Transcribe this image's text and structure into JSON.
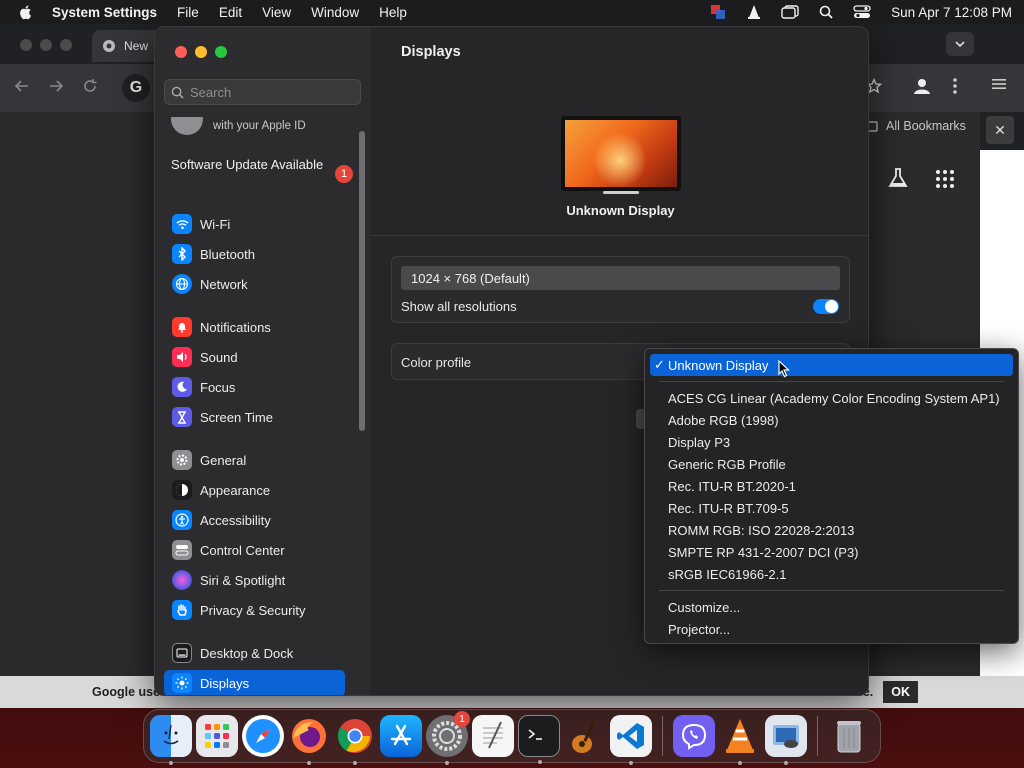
{
  "menubar": {
    "app_name": "System Settings",
    "menus": [
      "File",
      "Edit",
      "View",
      "Window",
      "Help"
    ],
    "clock": "Sun Apr 7  12:08 PM"
  },
  "browser": {
    "tab_title": "New",
    "google_letter": "G",
    "bookmarks_label": "All Bookmarks",
    "cookie_text": "Google use",
    "cookie_tail": "e.",
    "ok_label": "OK"
  },
  "settings": {
    "search_placeholder": "Search",
    "apple_id_sub": "with your Apple ID",
    "update_label": "Software Update Available",
    "update_badge": "1",
    "sidebar_items": [
      {
        "label": "Wi-Fi",
        "icon": "wifi-icon",
        "color": "#0a84ff"
      },
      {
        "label": "Bluetooth",
        "icon": "bluetooth-icon",
        "color": "#0a84ff"
      },
      {
        "label": "Network",
        "icon": "network-icon",
        "color": "#0a84ff"
      },
      {
        "label": "Notifications",
        "icon": "notifications-icon",
        "color": "#ff3b30"
      },
      {
        "label": "Sound",
        "icon": "sound-icon",
        "color": "#ff2d55"
      },
      {
        "label": "Focus",
        "icon": "focus-icon",
        "color": "#5e5ce6"
      },
      {
        "label": "Screen Time",
        "icon": "screen-time-icon",
        "color": "#5e5ce6"
      },
      {
        "label": "General",
        "icon": "gear-icon",
        "color": "#8e8e93"
      },
      {
        "label": "Appearance",
        "icon": "appearance-icon",
        "color": "#1c1c1e"
      },
      {
        "label": "Accessibility",
        "icon": "accessibility-icon",
        "color": "#0a84ff"
      },
      {
        "label": "Control Center",
        "icon": "control-center-icon",
        "color": "#8e8e93"
      },
      {
        "label": "Siri & Spotlight",
        "icon": "siri-icon",
        "color": "#bf5af2"
      },
      {
        "label": "Privacy & Security",
        "icon": "hand-icon",
        "color": "#0a84ff"
      },
      {
        "label": "Desktop & Dock",
        "icon": "dock-icon",
        "color": "#1c1c1e"
      },
      {
        "label": "Displays",
        "icon": "displays-icon",
        "color": "#0a84ff"
      }
    ],
    "page_title": "Displays",
    "display_name": "Unknown Display",
    "resolution": "1024 × 768 (Default)",
    "show_all_resolutions": "Show all resolutions",
    "show_all_resolutions_on": true,
    "color_profile_label": "Color profile"
  },
  "dropdown": {
    "selected": "Unknown Display",
    "items": [
      "ACES CG Linear (Academy Color Encoding System AP1)",
      "Adobe RGB (1998)",
      "Display P3",
      "Generic RGB Profile",
      "Rec. ITU-R BT.2020-1",
      "Rec. ITU-R BT.709-5",
      "ROMM RGB: ISO 22028-2:2013",
      "SMPTE RP 431-2-2007 DCI (P3)",
      "sRGB IEC61966-2.1"
    ],
    "extra_items": [
      "Customize...",
      "Projector..."
    ]
  },
  "dock": {
    "apps": [
      "finder",
      "launchpad",
      "safari",
      "firefox",
      "chrome",
      "app-store",
      "system-settings",
      "textedit",
      "terminal",
      "garageband",
      "vscode",
      "viber",
      "vlc",
      "preview",
      "trash"
    ],
    "settings_badge": "1"
  }
}
